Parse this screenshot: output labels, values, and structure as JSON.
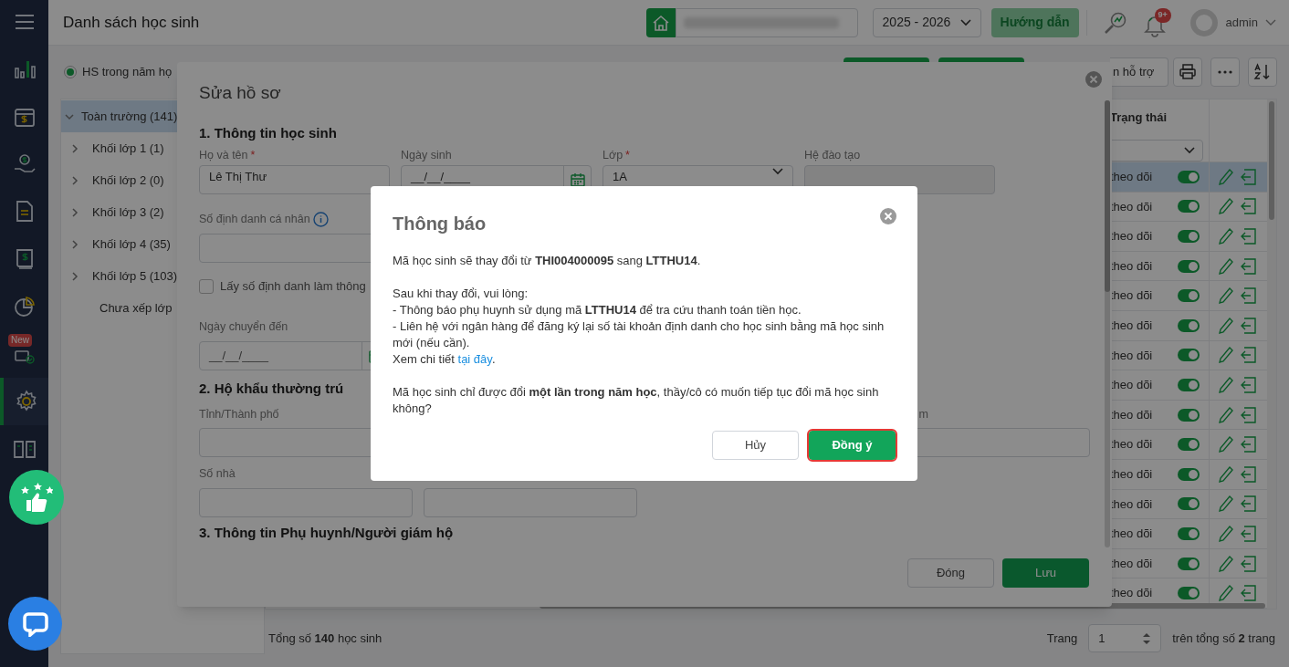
{
  "sidebar": {
    "items": [
      {
        "selected": false
      },
      {
        "selected": false
      },
      {
        "selected": false
      },
      {
        "selected": false
      },
      {
        "selected": false
      },
      {
        "selected": false
      },
      {
        "selected": false,
        "badge": "New"
      },
      {
        "selected": true
      },
      {
        "selected": false
      }
    ]
  },
  "header": {
    "title": "Danh sách học sinh",
    "year": "2025 - 2026",
    "guide_button": "Hướng dẫn",
    "notification_count": "9+",
    "user": "admin"
  },
  "toolbar": {
    "filter_radio": {
      "label": "HS trong năm họ",
      "selected": true
    },
    "support_button": "n hỗ trợ"
  },
  "tree": [
    {
      "label": "Toàn trường (141)",
      "kind": "group",
      "expanded": true,
      "selected": true,
      "children": [
        {
          "label": "Khối lớp 1 (1)",
          "kind": "group",
          "expanded": false,
          "selected": false
        },
        {
          "label": "Khối lớp 2 (0)",
          "kind": "group",
          "expanded": false,
          "selected": false
        },
        {
          "label": "Khối lớp 3 (2)",
          "kind": "group",
          "expanded": false,
          "selected": false
        },
        {
          "label": "Khối lớp 4 (35)",
          "kind": "group",
          "expanded": false,
          "selected": false
        },
        {
          "label": "Khối lớp 5 (103)",
          "kind": "group",
          "expanded": false,
          "selected": false
        },
        {
          "label": "Chưa xếp lớp",
          "kind": "leaf",
          "selected": false
        }
      ]
    }
  ],
  "table": {
    "columns": [
      "Trạng thái"
    ],
    "rows": [
      {
        "status": "theo dõi",
        "on": true,
        "selected": true
      },
      {
        "status": "theo dõi",
        "on": true,
        "selected": false
      },
      {
        "status": "theo dõi",
        "on": true,
        "selected": false
      },
      {
        "status": "theo dõi",
        "on": true,
        "selected": false
      },
      {
        "status": "theo dõi",
        "on": true,
        "selected": false
      },
      {
        "status": "theo dõi",
        "on": true,
        "selected": false
      },
      {
        "status": "theo dõi",
        "on": true,
        "selected": false
      },
      {
        "status": "theo dõi",
        "on": true,
        "selected": false
      },
      {
        "status": "theo dõi",
        "on": true,
        "selected": false
      },
      {
        "status": "theo dõi",
        "on": true,
        "selected": false
      },
      {
        "status": "theo dõi",
        "on": true,
        "selected": false
      },
      {
        "status": "theo dõi",
        "on": true,
        "selected": false
      },
      {
        "status": "theo dõi",
        "on": true,
        "selected": false
      },
      {
        "status": "theo dõi",
        "on": true,
        "selected": false
      },
      {
        "status": "theo dõi",
        "on": true,
        "selected": false
      }
    ]
  },
  "footer": {
    "total": "Tổng số **140** học sinh",
    "page_label": "Trang",
    "page": "1",
    "pages": "trên tổng số **2** trang"
  },
  "edit_dialog": {
    "title": "Sửa hồ sơ",
    "section_1": "1. Thông tin học sinh",
    "required_mark": "*",
    "fields": [
      {
        "label": "Họ và tên",
        "required": true,
        "kind": "text",
        "value": "Lê Thị Thư"
      },
      {
        "label": "Ngày sinh",
        "required": false,
        "kind": "date",
        "value": "__/__/____"
      },
      {
        "label": "Lớp",
        "required": true,
        "kind": "select",
        "value": "1A"
      },
      {
        "label": "Hệ đào tạo",
        "required": false,
        "kind": "disabled"
      }
    ],
    "id_label": "Số định danh cá nhân",
    "checkbox": {
      "label": "Lấy số định danh làm thông",
      "checked": false
    },
    "transfer_label": "Ngày chuyển đến",
    "transfer_placeholder": "__/__/____",
    "section_2": "2. Hộ khẩu thường trú",
    "province_label": "Tỉnh/Thành phố",
    "right_label": "m",
    "house_label": "Số nhà",
    "section_3": "3. Thông tin Phụ huynh/Người giám hộ",
    "close_button": "Đóng",
    "save_button": "Lưu"
  },
  "notice": {
    "title": "Thông báo",
    "message": "Mã học sinh sẽ thay đổi từ **THI004000095** sang **LTTHU14**.",
    "intro": "Sau khi thay đổi, vui lòng:",
    "steps": [
      "- Thông báo phụ huynh sử dụng mã **LTTHU14** để tra cứu thanh toán tiền học.",
      "- Liên hệ với ngân hàng để đăng ký lại số tài khoản định danh cho học sinh bằng mã học sinh mới (nếu cần)."
    ],
    "detail": {
      "prefix": "Xem chi tiết ",
      "link": "tại đây",
      "suffix": "."
    },
    "question": "Mã học sinh chỉ được đổi **một lần trong năm học**, thầy/cô có muốn tiếp tục đổi mã học sinh không?",
    "buttons": [
      {
        "label": "Hủy",
        "kind": "secondary",
        "highlighted": false
      },
      {
        "label": "Đồng ý",
        "kind": "primary",
        "highlighted": true
      }
    ]
  }
}
